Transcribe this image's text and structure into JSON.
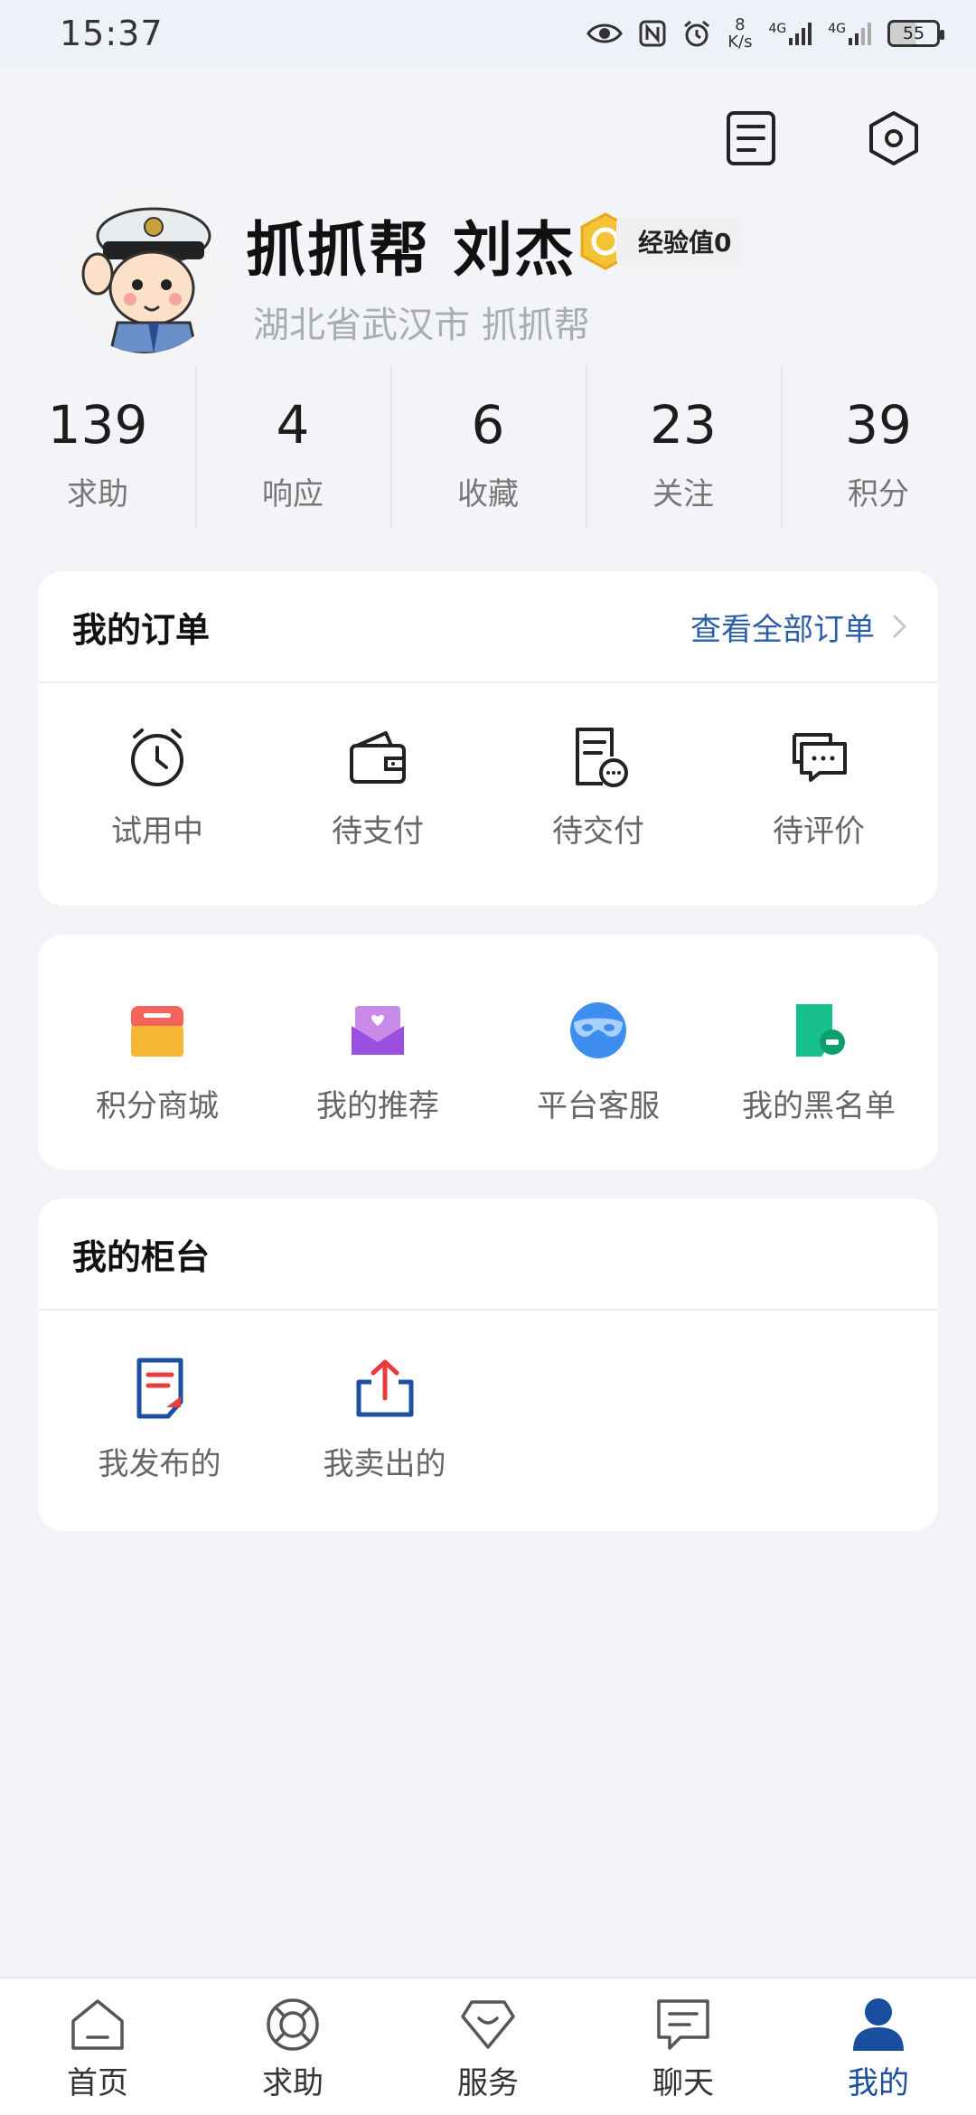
{
  "status_bar": {
    "time": "15:37",
    "speed_top": "8",
    "speed_bottom": "K/s",
    "signal_label_1": "4G",
    "signal_label_2": "4G",
    "battery": "55",
    "icons": [
      "eye-icon",
      "nfc-icon",
      "alarm-icon",
      "signal-icon",
      "signal-icon",
      "battery-icon"
    ]
  },
  "header": {
    "icons": [
      "document-icon",
      "settings-hexagon-icon"
    ]
  },
  "profile": {
    "name": "抓抓帮 刘杰",
    "exp_label": "经验值0",
    "location": "湖北省武汉市 抓抓帮"
  },
  "stats": [
    {
      "value": "139",
      "label": "求助"
    },
    {
      "value": "4",
      "label": "响应"
    },
    {
      "value": "6",
      "label": "收藏"
    },
    {
      "value": "23",
      "label": "关注"
    },
    {
      "value": "39",
      "label": "积分"
    }
  ],
  "orders": {
    "title": "我的订单",
    "view_all": "查看全部订单",
    "items": [
      {
        "label": "试用中",
        "icon": "clock-icon"
      },
      {
        "label": "待支付",
        "icon": "wallet-icon"
      },
      {
        "label": "待交付",
        "icon": "document-pending-icon"
      },
      {
        "label": "待评价",
        "icon": "chat-bubbles-icon"
      }
    ]
  },
  "services": {
    "items": [
      {
        "label": "积分商城",
        "icon": "shop-icon"
      },
      {
        "label": "我的推荐",
        "icon": "heart-envelope-icon"
      },
      {
        "label": "平台客服",
        "icon": "mask-icon"
      },
      {
        "label": "我的黑名单",
        "icon": "blacklist-icon"
      }
    ]
  },
  "counter": {
    "title": "我的柜台",
    "items": [
      {
        "label": "我发布的",
        "icon": "publish-icon"
      },
      {
        "label": "我卖出的",
        "icon": "share-upload-icon"
      }
    ]
  },
  "tabbar": {
    "active": "我的",
    "items": [
      {
        "label": "首页",
        "icon": "home-icon"
      },
      {
        "label": "求助",
        "icon": "lifebuoy-icon"
      },
      {
        "label": "服务",
        "icon": "service-icon"
      },
      {
        "label": "聊天",
        "icon": "chat-icon"
      },
      {
        "label": "我的",
        "icon": "person-icon"
      }
    ]
  },
  "colors": {
    "accent": "#1a4fa0",
    "background": "#f3f4f8",
    "link": "#2a5ea8"
  }
}
